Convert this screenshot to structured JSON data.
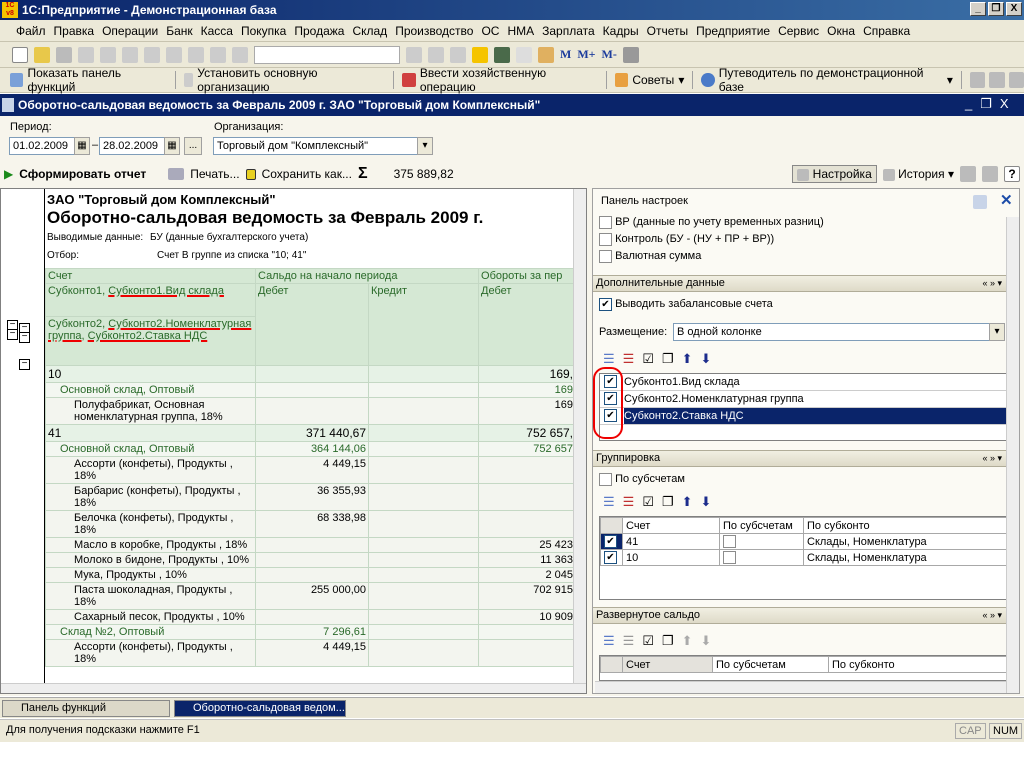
{
  "app": {
    "title": "1С:Предприятие - Демонстрационная база",
    "logo_text": "1C v8"
  },
  "menu": [
    "Файл",
    "Правка",
    "Операции",
    "Банк",
    "Касса",
    "Покупка",
    "Продажа",
    "Склад",
    "Производство",
    "ОС",
    "НМА",
    "Зарплата",
    "Кадры",
    "Отчеты",
    "Предприятие",
    "Сервис",
    "Окна",
    "Справка"
  ],
  "toolbar2": {
    "show_panel": "Показать панель функций",
    "set_org": "Установить основную организацию",
    "enter_op": "Ввести хозяйственную операцию",
    "tips": "Советы",
    "guide": "Путеводитель по демонстрационной базе"
  },
  "window": {
    "title": "Оборотно-сальдовая ведомость за Февраль 2009 г. ЗАО \"Торговый дом Комплексный\""
  },
  "form": {
    "period_label": "Период:",
    "date_from": "01.02.2009",
    "date_to": "28.02.2009",
    "dash": "–",
    "dots": "...",
    "org_label": "Организация:",
    "org_value": "Торговый дом \"Комплексный\"",
    "generate": "Сформировать отчет",
    "print": "Печать...",
    "save_as": "Сохранить как...",
    "sum_symbol": "Σ",
    "sum_value": "375 889,82",
    "settings": "Настройка",
    "history": "История"
  },
  "report": {
    "company": "ЗАО \"Торговый дом Комплексный\"",
    "title": "Оборотно-сальдовая ведомость за Февраль 2009 г.",
    "output_label": "Выводимые данные:",
    "output_value": "БУ (данные бухгалтерского учета)",
    "filter_label": "Отбор:",
    "filter_value": "Счет В группе из списка \"10; 41\"",
    "headers": {
      "account": "Счет",
      "saldo_start": "Сальдо на начало периода",
      "turnover": "Обороты за пер",
      "debit": "Дебет",
      "credit": "Кредит",
      "sub1_a": "Субконто1, ",
      "sub1_b": "Субконто1.Вид склада",
      "sub2_a": "Субконто2, ",
      "sub2_b": "Субконто2.Номенклатурная группа",
      "sub2_c": ", ",
      "sub2_d": "Субконто2.Ставка НДС"
    },
    "rows": [
      {
        "type": "acc",
        "text": "10",
        "d": "",
        "c": "",
        "t": "169,"
      },
      {
        "type": "sub",
        "text": "Основной склад, Оптовый",
        "d": "",
        "c": "",
        "t": "169"
      },
      {
        "type": "item",
        "text": "Полуфабрикат, Основная номенклатурная группа, 18%",
        "d": "",
        "c": "",
        "t": "169"
      },
      {
        "type": "acc",
        "text": "41",
        "d": "371 440,67",
        "c": "",
        "t": "752 657,"
      },
      {
        "type": "sub",
        "text": "Основной склад, Оптовый",
        "d": "364 144,06",
        "c": "",
        "t": "752 657"
      },
      {
        "type": "item",
        "text": "Ассорти (конфеты), Продукты , 18%",
        "d": "4 449,15",
        "c": "",
        "t": ""
      },
      {
        "type": "item",
        "text": "Барбарис (конфеты), Продукты , 18%",
        "d": "36 355,93",
        "c": "",
        "t": ""
      },
      {
        "type": "item",
        "text": "Белочка (конфеты), Продукты , 18%",
        "d": "68 338,98",
        "c": "",
        "t": ""
      },
      {
        "type": "item",
        "text": "Масло в коробке, Продукты , 18%",
        "d": "",
        "c": "",
        "t": "25 423"
      },
      {
        "type": "item",
        "text": "Молоко в бидоне, Продукты , 10%",
        "d": "",
        "c": "",
        "t": "11 363"
      },
      {
        "type": "item",
        "text": "Мука, Продукты , 10%",
        "d": "",
        "c": "",
        "t": "2 045"
      },
      {
        "type": "item",
        "text": "Паста шоколадная, Продукты , 18%",
        "d": "255 000,00",
        "c": "",
        "t": "702 915"
      },
      {
        "type": "item",
        "text": "Сахарный песок, Продукты , 10%",
        "d": "",
        "c": "",
        "t": "10 909"
      },
      {
        "type": "sub",
        "text": "Склад №2, Оптовый",
        "d": "7 296,61",
        "c": "",
        "t": ""
      },
      {
        "type": "item",
        "text": "Ассорти (конфеты), Продукты , 18%",
        "d": "4 449,15",
        "c": "",
        "t": ""
      }
    ]
  },
  "panel": {
    "title": "Панель настроек",
    "top_checks": [
      {
        "label": "ВР (данные по учету временных разниц)",
        "checked": false
      },
      {
        "label": "Контроль (БУ - (НУ + ПР + ВР))",
        "checked": false
      },
      {
        "label": "Валютная сумма",
        "checked": false
      }
    ],
    "extra": {
      "title": "Дополнительные данные",
      "offbalance": "Выводить забалансовые счета",
      "placement_label": "Размещение:",
      "placement_value": "В одной колонке",
      "items": [
        {
          "label": "Субконто1.Вид склада",
          "checked": true
        },
        {
          "label": "Субконто2.Номенклатурная группа",
          "checked": true
        },
        {
          "label": "Субконто2.Ставка НДС",
          "checked": true,
          "selected": true
        }
      ]
    },
    "grouping": {
      "title": "Группировка",
      "by_sub": "По субсчетам",
      "cols": [
        "Счет",
        "По субсчетам",
        "По субконто"
      ],
      "rows": [
        {
          "account": "41",
          "sub": false,
          "subconto": "Склады, Номенклатура",
          "checked": true
        },
        {
          "account": "10",
          "sub": false,
          "subconto": "Склады, Номенклатура",
          "checked": true
        }
      ]
    },
    "expanded": {
      "title": "Развернутое сальдо",
      "cols": [
        "Счет",
        "По субсчетам",
        "По субконто"
      ]
    },
    "arrows": "« » ▾"
  },
  "taskbar": {
    "item1": "Панель функций",
    "item2": "Оборотно-сальдовая ведом..."
  },
  "status": {
    "hint": "Для получения подсказки нажмите F1",
    "cap": "CAP",
    "num": "NUM"
  },
  "colors": {
    "title_bar": "#0a246a",
    "report_header": "#d5e8d4",
    "annotation": "#e00000"
  }
}
